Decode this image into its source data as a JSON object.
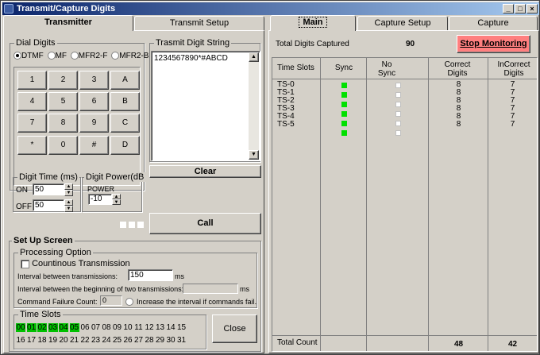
{
  "window": {
    "title": "Transmit/Capture Digits"
  },
  "left_tabs": [
    {
      "label": "Transmitter"
    },
    {
      "label": "Transmit Setup"
    }
  ],
  "dial_digits": {
    "label": "Dial Digits",
    "modes": [
      "DTMF",
      "MF",
      "MFR2-F",
      "MFR2-B"
    ],
    "selected": "DTMF",
    "keys": [
      "1",
      "2",
      "3",
      "A",
      "4",
      "5",
      "6",
      "B",
      "7",
      "8",
      "9",
      "C",
      "*",
      "0",
      "#",
      "D"
    ]
  },
  "digit_string": {
    "label": "Trasmit Digit String",
    "value": "1234567890*#ABCD"
  },
  "clear_label": "Clear",
  "call_label": "Call",
  "digit_time": {
    "label": "Digit Time (ms)",
    "on_label": "ON",
    "on_value": "50",
    "off_label": "OFF",
    "off_value": "50"
  },
  "digit_power": {
    "label": "Digit Power(dB",
    "power_label": "POWER",
    "value": "-10"
  },
  "setup_screen": {
    "label": "Set Up Screen",
    "processing_label": "Processing Option",
    "continuous_label": "Countinous Transmission",
    "interval_label": "Interval between transmissions:",
    "interval_value": "150",
    "interval_unit": "ms",
    "interval2_label": "Interval between the beginning of two transmissions:",
    "interval2_value": "",
    "interval2_unit": "ms",
    "failure_label": "Command Failure Count:",
    "failure_value": "0",
    "increase_label": "Increase the interval if commands fail."
  },
  "time_slots": {
    "label": "Time Slots",
    "row1": [
      "00",
      "01",
      "02",
      "03",
      "04",
      "05",
      "06",
      "07",
      "08",
      "09",
      "10",
      "11",
      "12",
      "13",
      "14",
      "15"
    ],
    "row2": [
      "16",
      "17",
      "18",
      "19",
      "20",
      "21",
      "22",
      "23",
      "24",
      "25",
      "26",
      "27",
      "28",
      "29",
      "30",
      "31"
    ],
    "active": [
      "00",
      "01",
      "02",
      "03",
      "04",
      "05"
    ]
  },
  "close_label": "Close",
  "right_tabs": [
    {
      "label": "Main"
    },
    {
      "label": "Capture Setup"
    },
    {
      "label": "Capture"
    }
  ],
  "capture": {
    "total_label": "Total Digits Captured",
    "total_value": "90",
    "stop_label": "Stop Monitoring",
    "headers": {
      "slots": "Time Slots",
      "sync": "Sync",
      "nosync": "No Sync",
      "correct": "Correct Digits",
      "incorrect": "InCorrect Digits"
    },
    "rows": [
      {
        "slot": "TS-0",
        "sync": true,
        "correct": "8",
        "incorrect": "7"
      },
      {
        "slot": "TS-1",
        "sync": true,
        "correct": "8",
        "incorrect": "7"
      },
      {
        "slot": "TS-2",
        "sync": true,
        "correct": "8",
        "incorrect": "7"
      },
      {
        "slot": "TS-3",
        "sync": true,
        "correct": "8",
        "incorrect": "7"
      },
      {
        "slot": "TS-4",
        "sync": true,
        "correct": "8",
        "incorrect": "7"
      },
      {
        "slot": "TS-5",
        "sync": true,
        "correct": "8",
        "incorrect": "7"
      }
    ],
    "total_count_label": "Total Count",
    "total_correct": "48",
    "total_incorrect": "42"
  }
}
